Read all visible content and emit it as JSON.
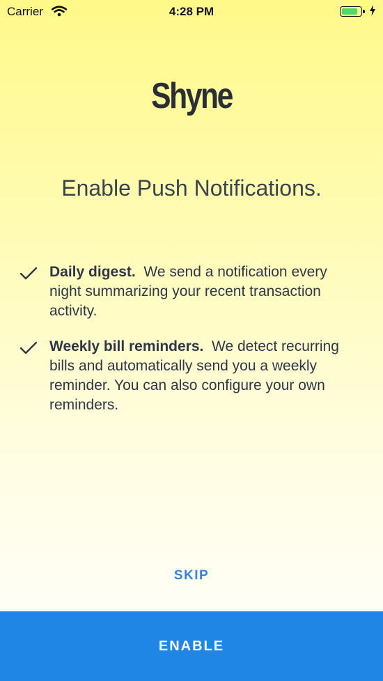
{
  "status_bar": {
    "carrier": "Carrier",
    "time": "4:28 PM",
    "battery_color": "#4cd964"
  },
  "brand": {
    "logo_text": "Shyne"
  },
  "title": "Enable Push Notifications.",
  "features": [
    {
      "icon": "check-icon",
      "heading": "Daily digest.",
      "description": "We send a notification every night summarizing your recent transaction activity."
    },
    {
      "icon": "check-icon",
      "heading": "Weekly bill reminders.",
      "description": "We detect recurring bills and automatically send you a weekly reminder. You can also configure your own reminders."
    }
  ],
  "actions": {
    "skip_label": "SKIP",
    "enable_label": "ENABLE"
  },
  "colors": {
    "accent": "#1f86e5",
    "background_top": "#fff98a",
    "text": "#2d3748"
  }
}
